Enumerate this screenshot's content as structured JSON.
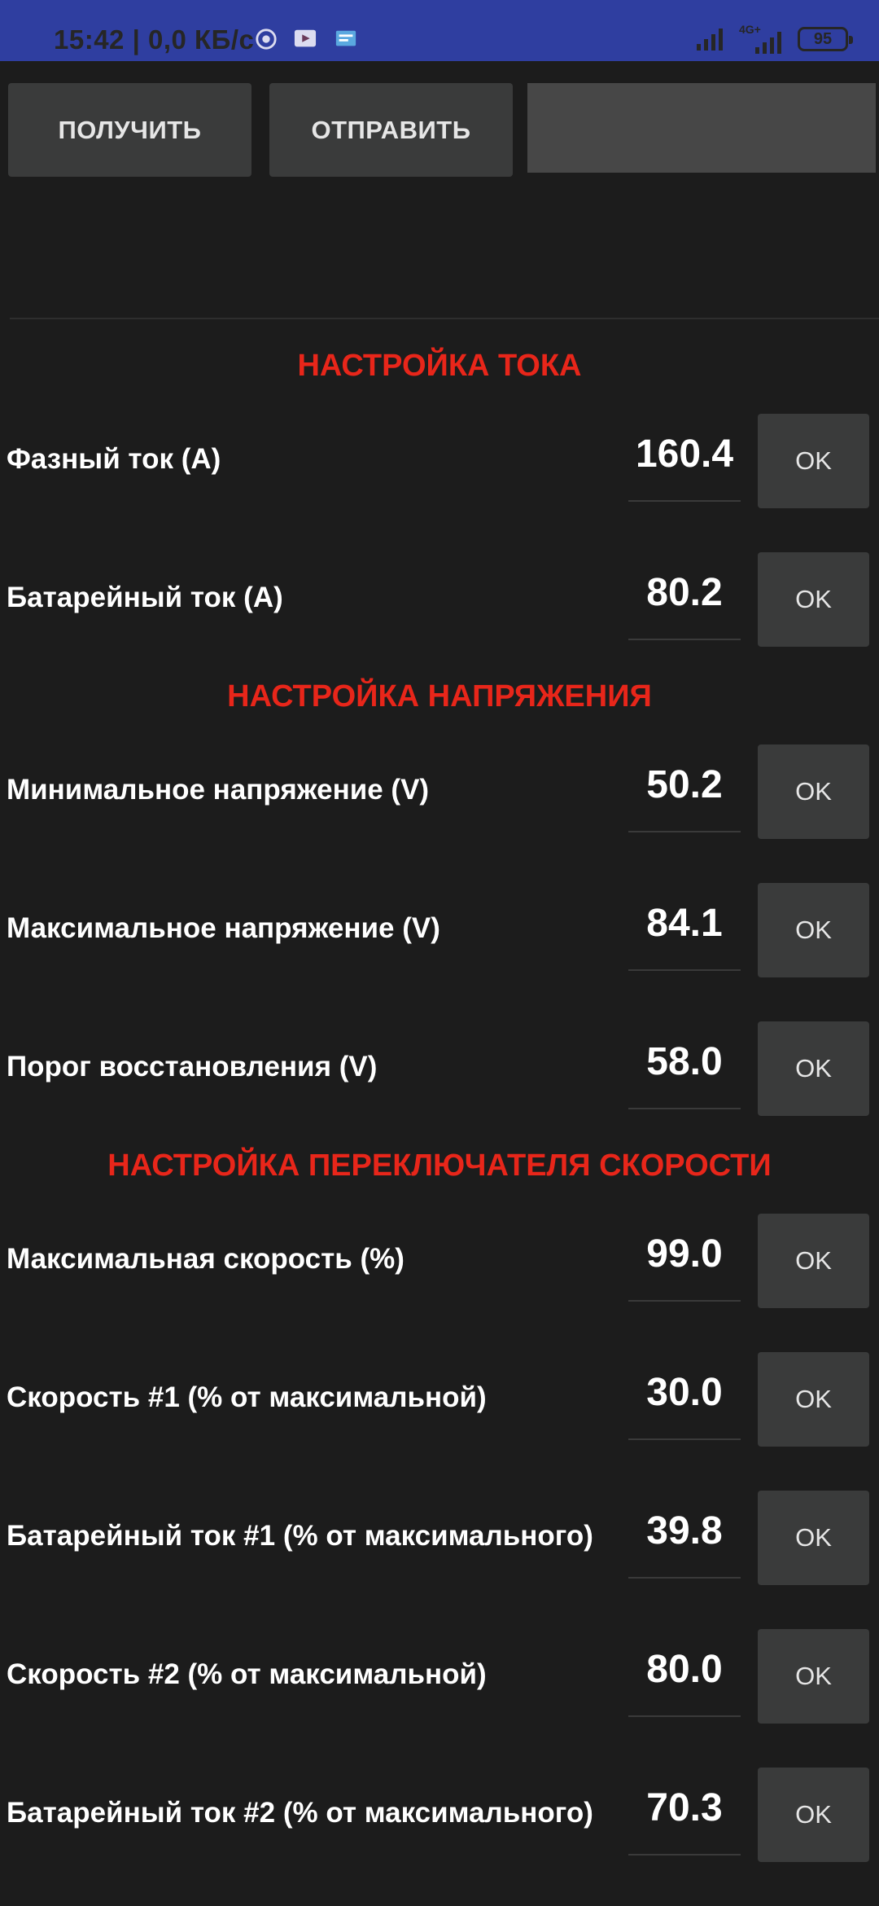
{
  "status_bar": {
    "time": "15:42 | 0,0 КБ/с",
    "network_type": "4G+",
    "battery_level": "95",
    "notification_icons": [
      "vpn-icon",
      "media-icon",
      "message-icon"
    ]
  },
  "toolbar": {
    "receive_label": "ПОЛУЧИТЬ",
    "send_label": "ОТПРАВИТЬ",
    "input_value": ""
  },
  "sections": [
    {
      "title": "НАСТРОЙКА ТОКА",
      "rows": [
        {
          "label": "Фазный ток (А)",
          "value": "160.4",
          "button": "OK"
        },
        {
          "label": "Батарейный ток (А)",
          "value": "80.2",
          "button": "OK"
        }
      ]
    },
    {
      "title": "НАСТРОЙКА НАПРЯЖЕНИЯ",
      "rows": [
        {
          "label": "Минимальное напряжение (V)",
          "value": "50.2",
          "button": "OK"
        },
        {
          "label": "Максимальное напряжение (V)",
          "value": "84.1",
          "button": "OK"
        },
        {
          "label": "Порог восстановления (V)",
          "value": "58.0",
          "button": "OK"
        }
      ]
    },
    {
      "title": "НАСТРОЙКА ПЕРЕКЛЮЧАТЕЛЯ СКОРОСТИ",
      "rows": [
        {
          "label": "Максимальная скорость (%)",
          "value": "99.0",
          "button": "OK"
        },
        {
          "label": "Скорость #1 (% от максимальной)",
          "value": "30.0",
          "button": "OK"
        },
        {
          "label": "Батарейный ток #1 (% от максимального)",
          "value": "39.8",
          "button": "OK"
        },
        {
          "label": "Скорость #2 (% от максимальной)",
          "value": "80.0",
          "button": "OK"
        },
        {
          "label": "Батарейный ток #2 (% от максимального)",
          "value": "70.3",
          "button": "OK"
        }
      ]
    }
  ],
  "colors": {
    "status_bar": "#2f3ea0",
    "background": "#1c1c1c",
    "section_title": "#e8261a",
    "button": "#3a3b3b"
  }
}
